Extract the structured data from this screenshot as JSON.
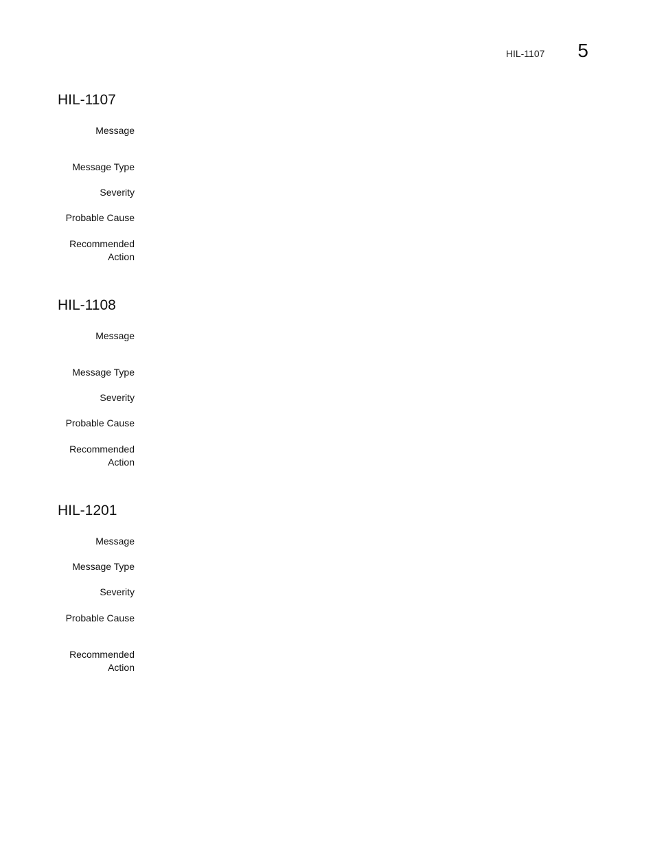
{
  "header": {
    "running_title": "HIL-1107",
    "chapter_number": "5"
  },
  "sections": [
    {
      "title": "HIL-1107",
      "fields": [
        {
          "label": "Message",
          "value": ""
        },
        {
          "label": "Message Type",
          "value": ""
        },
        {
          "label": "Severity",
          "value": ""
        },
        {
          "label": "Probable Cause",
          "value": ""
        },
        {
          "label": "Recommended Action",
          "value": ""
        }
      ]
    },
    {
      "title": "HIL-1108",
      "fields": [
        {
          "label": "Message",
          "value": ""
        },
        {
          "label": "Message Type",
          "value": ""
        },
        {
          "label": "Severity",
          "value": ""
        },
        {
          "label": "Probable Cause",
          "value": ""
        },
        {
          "label": "Recommended Action",
          "value": ""
        }
      ]
    },
    {
      "title": "HIL-1201",
      "fields": [
        {
          "label": "Message",
          "value": ""
        },
        {
          "label": "Message Type",
          "value": ""
        },
        {
          "label": "Severity",
          "value": ""
        },
        {
          "label": "Probable Cause",
          "value": ""
        },
        {
          "label": "Recommended Action",
          "value": ""
        }
      ]
    }
  ]
}
